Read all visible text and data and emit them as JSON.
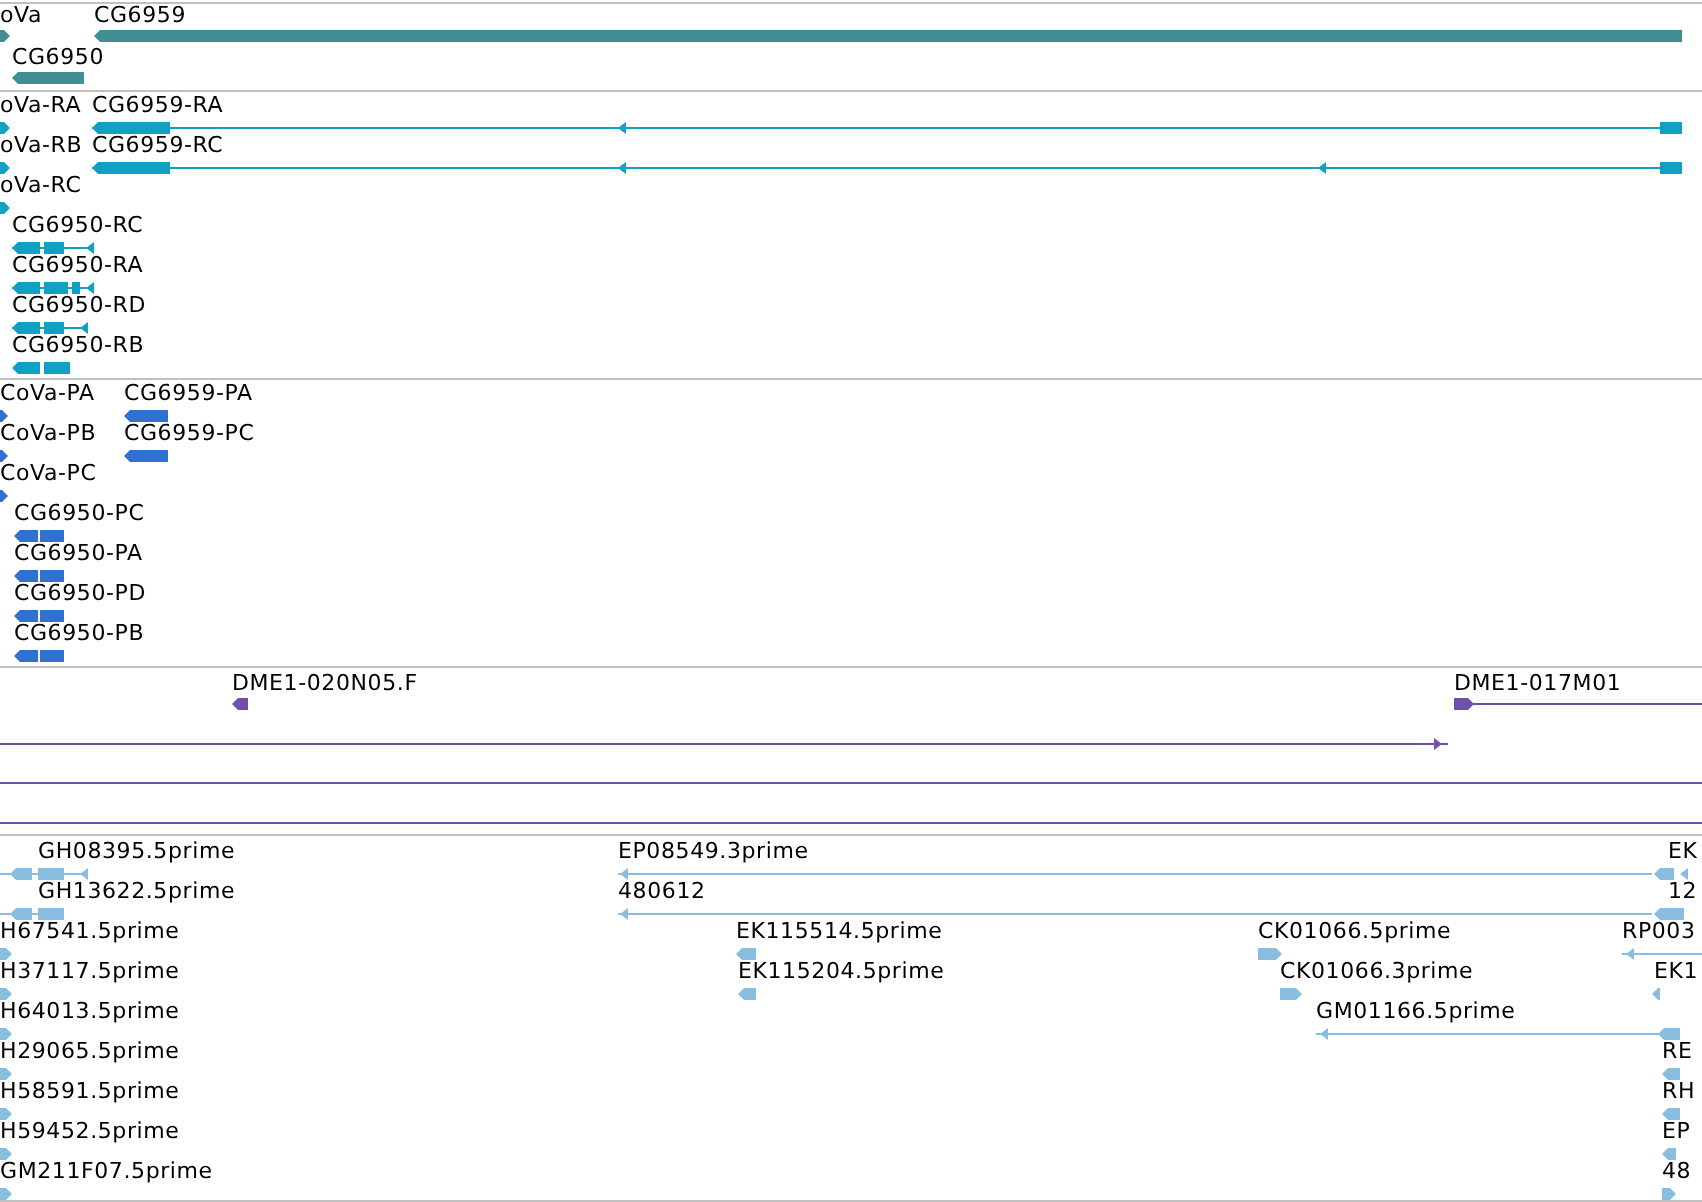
{
  "tracks": [
    {
      "color": "#3f8f94",
      "features": [
        {
          "label": "oVa",
          "reverse": false
        },
        {
          "label": "CG6959",
          "reverse": true
        },
        {
          "label": "CG6950",
          "reverse": true
        }
      ]
    },
    {
      "color": "#10a0c4",
      "features": [
        {
          "label": "oVa-RA",
          "reverse": false
        },
        {
          "label": "CG6959-RA",
          "reverse": true
        },
        {
          "label": "oVa-RB",
          "reverse": false
        },
        {
          "label": "CG6959-RC",
          "reverse": true
        },
        {
          "label": "oVa-RC",
          "reverse": false
        },
        {
          "label": "CG6950-RC",
          "reverse": true
        },
        {
          "label": "CG6950-RA",
          "reverse": true
        },
        {
          "label": "CG6950-RD",
          "reverse": true
        },
        {
          "label": "CG6950-RB",
          "reverse": true
        }
      ]
    },
    {
      "color": "#3070d0",
      "features": [
        {
          "label": "CoVa-PA",
          "reverse": false
        },
        {
          "label": "CG6959-PA",
          "reverse": true
        },
        {
          "label": "CoVa-PB",
          "reverse": false
        },
        {
          "label": "CG6959-PC",
          "reverse": true
        },
        {
          "label": "CoVa-PC",
          "reverse": false
        },
        {
          "label": "CG6950-PC",
          "reverse": true
        },
        {
          "label": "CG6950-PA",
          "reverse": true
        },
        {
          "label": "CG6950-PD",
          "reverse": true
        },
        {
          "label": "CG6950-PB",
          "reverse": true
        }
      ]
    },
    {
      "color": "#7050a8",
      "features": [
        {
          "label": "DME1-020N05.F",
          "reverse": true
        },
        {
          "label": "DME1-017M01",
          "reverse": false
        },
        {
          "reverse": false
        }
      ]
    },
    {
      "color": "#88bde0",
      "features": [
        {
          "label": "GH08395.5prime",
          "reverse": true
        },
        {
          "label": "GH13622.5prime",
          "reverse": true
        },
        {
          "label": "H67541.5prime",
          "reverse": false
        },
        {
          "label": "H37117.5prime",
          "reverse": false
        },
        {
          "label": "H64013.5prime",
          "reverse": false
        },
        {
          "label": "H29065.5prime",
          "reverse": false
        },
        {
          "label": "H58591.5prime",
          "reverse": false
        },
        {
          "label": "H59452.5prime",
          "reverse": false
        },
        {
          "label": "GM211F07.5prime",
          "reverse": false
        },
        {
          "label": "EP08549.3prime",
          "reverse": true
        },
        {
          "label": "480612",
          "reverse": true
        },
        {
          "label": "EK115514.5prime",
          "reverse": true
        },
        {
          "label": "EK115204.5prime",
          "reverse": true
        },
        {
          "label": "CK01066.5prime",
          "reverse": false
        },
        {
          "label": "CK01066.3prime",
          "reverse": false
        },
        {
          "label": "GM01166.5prime",
          "reverse": true
        },
        {
          "label": "EK",
          "reverse": true
        },
        {
          "label": "12",
          "reverse": true
        },
        {
          "label": "RP003",
          "reverse": true
        },
        {
          "label": "EK1",
          "reverse": true
        },
        {
          "label": "RE",
          "reverse": true
        },
        {
          "label": "RH",
          "reverse": true
        },
        {
          "label": "EP",
          "reverse": true
        },
        {
          "label": "48",
          "reverse": false
        }
      ]
    }
  ]
}
